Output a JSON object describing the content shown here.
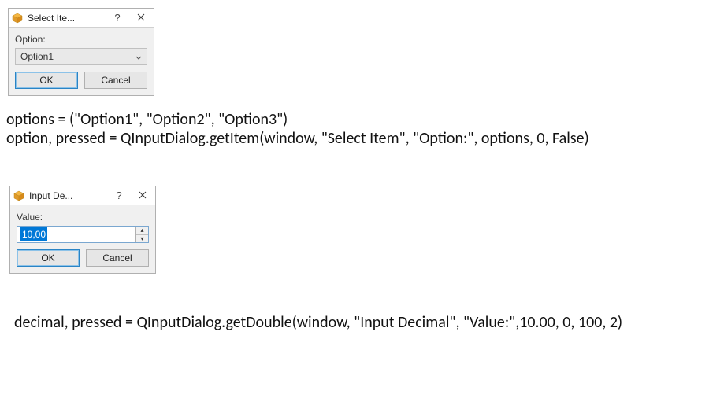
{
  "dialog1": {
    "title": "Select Ite...",
    "label": "Option:",
    "selected": "Option1",
    "ok": "OK",
    "cancel": "Cancel"
  },
  "dialog2": {
    "title": "Input De...",
    "label": "Value:",
    "value": "10,00",
    "ok": "OK",
    "cancel": "Cancel"
  },
  "code": {
    "line1": "options = (\"Option1\", \"Option2\", \"Option3\")",
    "line2": "option, pressed = QInputDialog.getItem(window, \"Select Item\", \"Option:\", options, 0, False)",
    "line3": "decimal, pressed = QInputDialog.getDouble(window, \"Input Decimal\", \"Value:\",10.00, 0, 100, 2)"
  }
}
